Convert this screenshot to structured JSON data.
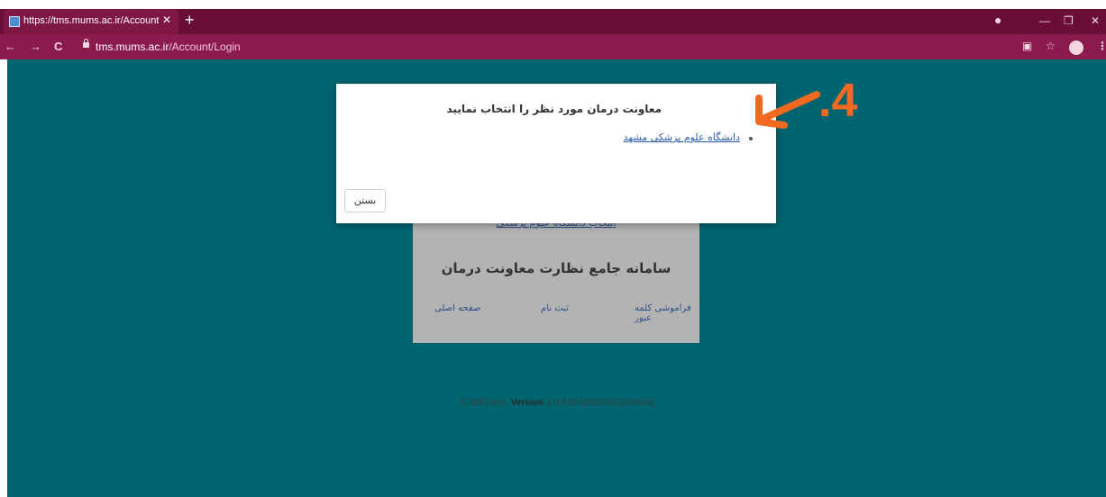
{
  "browser": {
    "tab_title": "https://tms.mums.ac.ir/Account/",
    "tab_close": "✕",
    "new_tab": "+",
    "nav_back": "←",
    "nav_forward": "→",
    "nav_reload": "C",
    "url_host": "tms.mums.ac.ir",
    "url_path": "/Account/Login",
    "min": "—",
    "max": "❐",
    "close": "✕",
    "translate_icon": "▣",
    "star_icon": "☆",
    "menu_icon": "⋮"
  },
  "login_card": {
    "university_link": "انتخاب دانشگاه علوم پزشکی",
    "system_title": "سامانه جامع نظارت معاونت درمان",
    "forgot_password": "فراموشی کلمه عبور",
    "register": "ثبت نام",
    "home": "صفحه اصلی"
  },
  "footer": {
    "copyright": "© 2021 tms.",
    "version_label": "Version",
    "version_value": "1.0.8.55 [20211011110934]"
  },
  "modal": {
    "title": "معاونت درمان مورد نظر را انتخاب نمایید",
    "option": "دانشگاه علوم پزشکی مشهد",
    "close_button": "بستن"
  },
  "annotation": {
    "label": ".4",
    "color": "#f26a21"
  },
  "colors": {
    "page_bg": "#00646e",
    "tabbar": "#6b0e36",
    "toolbar": "#8a1b4c"
  }
}
